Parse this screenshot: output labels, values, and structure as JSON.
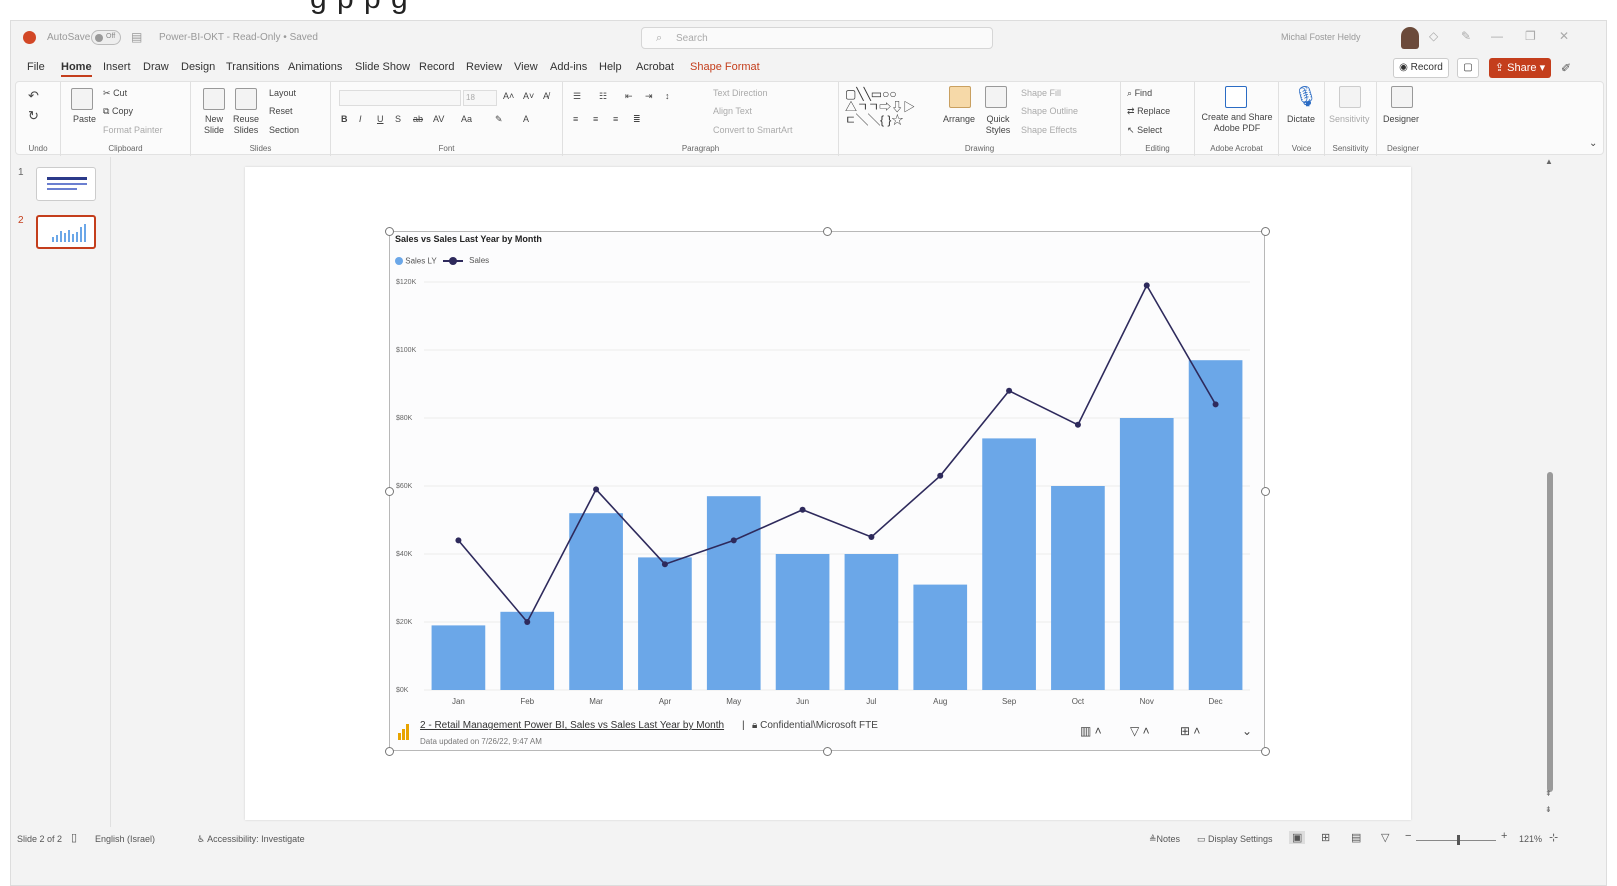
{
  "window": {
    "autosave_label": "AutoSave",
    "autosave_state": "Off",
    "doc_title": "Power-BI-OKT - Read-Only • Saved",
    "search_placeholder": "Search",
    "user_name": "Michal Foster Heldy",
    "brand_color": "#c43e1c"
  },
  "menu": {
    "items": [
      "File",
      "Home",
      "Insert",
      "Draw",
      "Design",
      "Transitions",
      "Animations",
      "Slide Show",
      "Record",
      "Review",
      "View",
      "Add-ins",
      "Help",
      "Acrobat",
      "Shape Format"
    ],
    "active": "Home",
    "record_label": "Record",
    "share_label": "Share"
  },
  "ribbon": {
    "undo": {
      "label": "Undo"
    },
    "clipboard": {
      "label": "Clipboard",
      "paste": "Paste",
      "cut": "Cut",
      "copy": "Copy",
      "format_painter": "Format Painter"
    },
    "slides": {
      "label": "Slides",
      "new_slide": "New Slide",
      "reuse": "Reuse Slides",
      "layout": "Layout",
      "reset": "Reset",
      "section": "Section"
    },
    "font": {
      "label": "Font",
      "size": "18"
    },
    "paragraph": {
      "label": "Paragraph",
      "text_direction": "Text Direction",
      "align_text": "Align Text",
      "convert": "Convert to SmartArt"
    },
    "drawing": {
      "label": "Drawing",
      "arrange": "Arrange",
      "quick_styles": "Quick Styles",
      "shape_fill": "Shape Fill",
      "shape_outline": "Shape Outline",
      "shape_effects": "Shape Effects"
    },
    "editing": {
      "label": "Editing",
      "find": "Find",
      "replace": "Replace",
      "select": "Select"
    },
    "acrobat": {
      "label": "Adobe Acrobat",
      "create": "Create and Share Adobe PDF"
    },
    "voice": {
      "label": "Voice",
      "dictate": "Dictate"
    },
    "sensitivity": {
      "label": "Sensitivity",
      "button": "Sensitivity"
    },
    "designer": {
      "label": "Designer",
      "button": "Designer"
    }
  },
  "thumbnails": [
    {
      "num": "1"
    },
    {
      "num": "2"
    }
  ],
  "chart_data": {
    "type": "bar",
    "title": "Sales vs Sales Last Year by Month",
    "categories": [
      "Jan",
      "Feb",
      "Mar",
      "Apr",
      "May",
      "Jun",
      "Jul",
      "Aug",
      "Sep",
      "Oct",
      "Nov",
      "Dec"
    ],
    "series": [
      {
        "name": "Sales LY",
        "type": "bar",
        "color": "#6ba7e8",
        "values": [
          19,
          23,
          52,
          39,
          57,
          40,
          40,
          31,
          74,
          60,
          80,
          97
        ]
      },
      {
        "name": "Sales",
        "type": "line",
        "color": "#2e2a5c",
        "values": [
          44,
          20,
          59,
          37,
          44,
          53,
          45,
          63,
          88,
          78,
          119,
          84
        ]
      }
    ],
    "yticks": [
      "$0K",
      "$20K",
      "$40K",
      "$60K",
      "$80K",
      "$100K",
      "$120K"
    ],
    "ylim": [
      0,
      120
    ],
    "xlabel": "",
    "ylabel": "",
    "grid": true,
    "legend": "top-left"
  },
  "chart_footer": {
    "link": "2 - Retail Management Power BI, Sales vs Sales Last Year by Month",
    "separator": "|",
    "confidential": "Confidential\\Microsoft FTE",
    "updated": "Data updated on 7/26/22, 9:47 AM"
  },
  "status": {
    "slide_info": "Slide 2 of 2",
    "language": "English (Israel)",
    "accessibility": "Accessibility: Investigate",
    "notes": "Notes",
    "display_settings": "Display Settings",
    "zoom": "121%"
  }
}
